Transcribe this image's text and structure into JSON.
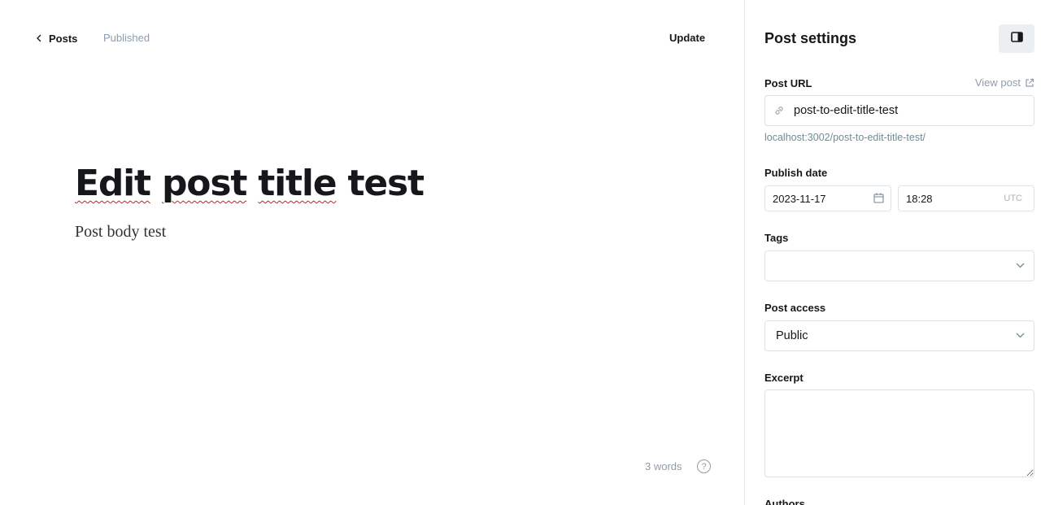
{
  "editor": {
    "back_label": "Posts",
    "status": "Published",
    "update_label": "Update",
    "title_words": [
      "Edit",
      "post",
      "title",
      "test"
    ],
    "body": "Post body test",
    "word_count": "3 words",
    "help_glyph": "?"
  },
  "settings": {
    "title": "Post settings",
    "post_url_label": "Post URL",
    "view_post_label": "View post",
    "slug": "post-to-edit-title-test",
    "url_hint": "localhost:3002/post-to-edit-title-test/",
    "publish_date_label": "Publish date",
    "date": "2023-11-17",
    "time": "18:28",
    "timezone": "UTC",
    "tags_label": "Tags",
    "tags_value": "",
    "post_access_label": "Post access",
    "post_access_value": "Public",
    "excerpt_label": "Excerpt",
    "excerpt_value": "",
    "authors_label": "Authors"
  },
  "icons": {
    "back": "chevron-left-icon",
    "help": "question-circle-icon",
    "panel_toggle": "sidebar-panel-icon",
    "view_post": "external-link-icon",
    "url": "link-icon",
    "date": "calendar-icon",
    "dropdown": "chevron-down-icon"
  },
  "colors": {
    "text": "#15171a",
    "muted": "#8e9cac",
    "border": "#dde1e5",
    "panel_toggle_bg": "#eceff1",
    "spellcheck": "#d01c1c"
  }
}
